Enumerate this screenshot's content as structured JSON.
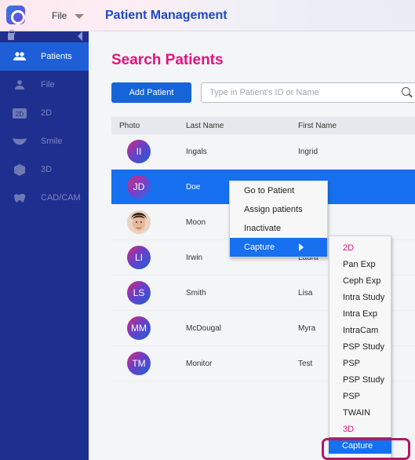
{
  "header": {
    "file_menu_label": "File",
    "app_title": "Patient Management"
  },
  "sidebar": {
    "items": [
      {
        "label": "Patients",
        "icon": "people-icon",
        "active": true
      },
      {
        "label": "File",
        "icon": "person-icon",
        "active": false
      },
      {
        "label": "2D",
        "icon": "2d-icon",
        "active": false
      },
      {
        "label": "Smile",
        "icon": "smile-icon",
        "active": false
      },
      {
        "label": "3D",
        "icon": "cube-icon",
        "active": false
      },
      {
        "label": "CAD/CAM",
        "icon": "tooth-icon",
        "active": false
      }
    ],
    "icon_2d_text": "2D"
  },
  "main": {
    "page_title": "Search Patients",
    "add_button_label": "Add Patient",
    "search_placeholder": "Type in Patient's ID or Name",
    "table": {
      "columns": [
        "Photo",
        "Last Name",
        "First Name"
      ],
      "rows": [
        {
          "initials": "II",
          "last": "Ingals",
          "first": "Ingrid",
          "selected": false
        },
        {
          "initials": "JD",
          "last": "Doe",
          "first": "",
          "selected": true
        },
        {
          "initials": "",
          "last": "Moon",
          "first": "",
          "selected": false
        },
        {
          "initials": "LI",
          "last": "Irwin",
          "first": "Laura",
          "selected": false
        },
        {
          "initials": "LS",
          "last": "Smith",
          "first": "Lisa",
          "selected": false
        },
        {
          "initials": "MM",
          "last": "McDougal",
          "first": "Myra",
          "selected": false
        },
        {
          "initials": "TM",
          "last": "Monitor",
          "first": "Test",
          "selected": false
        }
      ]
    }
  },
  "context_menu": {
    "items": [
      "Go to Patient",
      "Assign patients",
      "Inactivate",
      "Capture"
    ],
    "highlighted_index": 3
  },
  "capture_submenu": {
    "items": [
      {
        "label": "2D",
        "type": "group"
      },
      {
        "label": "Pan Exp",
        "type": "item"
      },
      {
        "label": "Ceph Exp",
        "type": "item"
      },
      {
        "label": "Intra Study",
        "type": "item"
      },
      {
        "label": "Intra Exp",
        "type": "item"
      },
      {
        "label": "IntraCam",
        "type": "item"
      },
      {
        "label": "PSP Study",
        "type": "item"
      },
      {
        "label": "PSP",
        "type": "item"
      },
      {
        "label": "PSP Study",
        "type": "item"
      },
      {
        "label": "PSP",
        "type": "item"
      },
      {
        "label": "TWAIN",
        "type": "item"
      },
      {
        "label": "3D",
        "type": "group"
      },
      {
        "label": "Capture",
        "type": "item"
      }
    ]
  },
  "colors": {
    "accent_pink": "#e5127d",
    "sidebar_bg": "#1f2f8f",
    "primary_blue": "#1670f0",
    "highlight_ring": "#b01a64"
  }
}
